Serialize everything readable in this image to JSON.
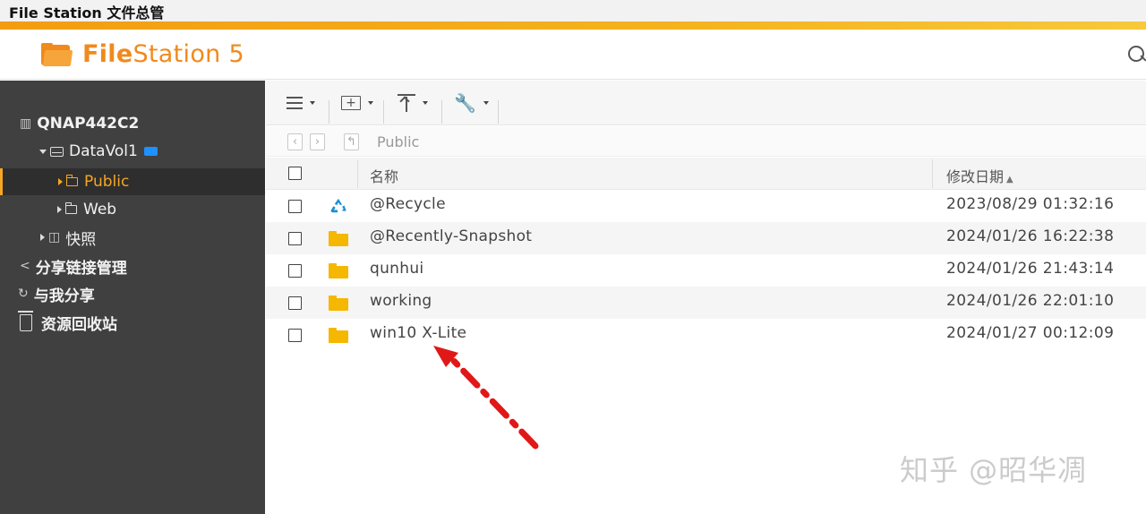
{
  "window": {
    "title": "File Station 文件总管"
  },
  "app": {
    "logo_bold": "File",
    "logo_rest": "Station 5"
  },
  "sidebar": {
    "items": [
      {
        "label": "QNAP442C2"
      },
      {
        "label": "DataVol1"
      },
      {
        "label": "Public"
      },
      {
        "label": "Web"
      },
      {
        "label": "快照"
      },
      {
        "label": "分享链接管理"
      },
      {
        "label": "与我分享"
      },
      {
        "label": "资源回收站"
      }
    ]
  },
  "path": {
    "current": "Public"
  },
  "table": {
    "columns": {
      "name": "名称",
      "modified": "修改日期"
    },
    "sort": {
      "column": "modified",
      "direction": "asc"
    },
    "rows": [
      {
        "name": "@Recycle",
        "modified": "2023/08/29 01:32:16",
        "icon": "recycle-icon"
      },
      {
        "name": "@Recently-Snapshot",
        "modified": "2024/01/26 16:22:38",
        "icon": "folder-icon"
      },
      {
        "name": "qunhui",
        "modified": "2024/01/26 21:43:14",
        "icon": "folder-icon"
      },
      {
        "name": "working",
        "modified": "2024/01/26 22:01:10",
        "icon": "folder-icon"
      },
      {
        "name": "win10 X-Lite",
        "modified": "2024/01/27 00:12:09",
        "icon": "folder-icon"
      }
    ]
  },
  "watermark": "知乎 @昭华凋",
  "colors": {
    "accent": "#f5a623",
    "sidebar_bg": "#404040",
    "folder": "#f5b700",
    "recycle": "#1a8fd6",
    "annotation": "#e01818"
  }
}
